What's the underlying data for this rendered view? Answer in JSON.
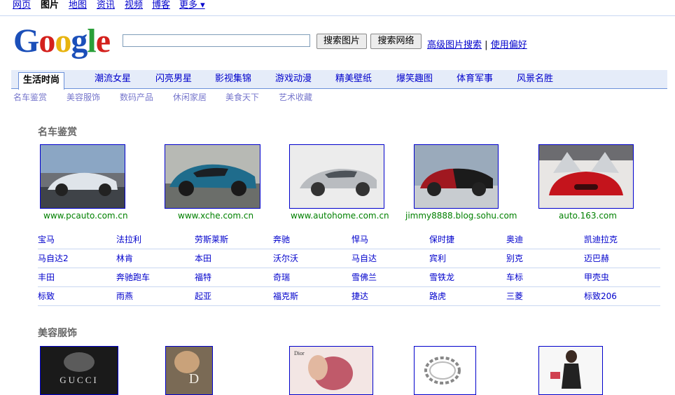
{
  "top_nav": [
    "网页",
    "图片",
    "地图",
    "资讯",
    "视频",
    "博客",
    "更多 ▾"
  ],
  "top_nav_current": "图片",
  "logo_text": "Google",
  "search": {
    "value": "",
    "btn_images": "搜索图片",
    "btn_web": "搜索网络",
    "advanced": "高级图片搜索",
    "separator": "|",
    "prefs": "使用偏好"
  },
  "tabs": [
    "生活时尚",
    "潮流女星",
    "闪亮男星",
    "影视集锦",
    "游戏动漫",
    "精美壁纸",
    "爆笑趣图",
    "体育军事",
    "风景名胜"
  ],
  "subcats": [
    "名车鉴赏",
    "美容服饰",
    "数码产品",
    "休闲家居",
    "美食天下",
    "艺术收藏"
  ],
  "sections": [
    {
      "title": "名车鉴赏",
      "thumbs": [
        {
          "icon": "silver-supercar-photo",
          "caption": "www.pcauto.com.cn"
        },
        {
          "icon": "blue-supercar-photo",
          "caption": "www.xche.com.cn"
        },
        {
          "icon": "silver-coupe-photo",
          "caption": "www.autohome.com.cn"
        },
        {
          "icon": "red-black-supercar-photo",
          "caption": "jimmy8888.blog.sohu.com"
        },
        {
          "icon": "red-concept-car-photo",
          "caption": "auto.163.com"
        }
      ],
      "brands": [
        [
          "宝马",
          "法拉利",
          "劳斯莱斯",
          "奔驰",
          "悍马",
          "保时捷",
          "奥迪",
          "凯迪拉克"
        ],
        [
          "马自达2",
          "林肯",
          "本田",
          "沃尔沃",
          "马自达",
          "宾利",
          "别克",
          "迈巴赫"
        ],
        [
          "丰田",
          "奔驰跑车",
          "福特",
          "奇瑞",
          "雪佛兰",
          "雪铁龙",
          "车标",
          "甲壳虫"
        ],
        [
          "标致",
          "雨燕",
          "起亚",
          "福克斯",
          "捷达",
          "路虎",
          "三菱",
          "标致206"
        ]
      ]
    },
    {
      "title": "美容服饰",
      "thumbs": [
        {
          "icon": "gucci-ad-photo",
          "overlay": "GUCCI"
        },
        {
          "icon": "dior-model-photo",
          "overlay": "D"
        },
        {
          "icon": "dior-perfume-photo",
          "overlay": "Dior"
        },
        {
          "icon": "bracelet-photo"
        },
        {
          "icon": "fashion-model-photo"
        }
      ]
    }
  ],
  "colors": {
    "link": "#0000cc",
    "caption": "#008000",
    "tab_bar": "#e5ecf9",
    "tab_border": "#6b90da",
    "subcat": "#7777cc",
    "section_title": "#666666"
  }
}
